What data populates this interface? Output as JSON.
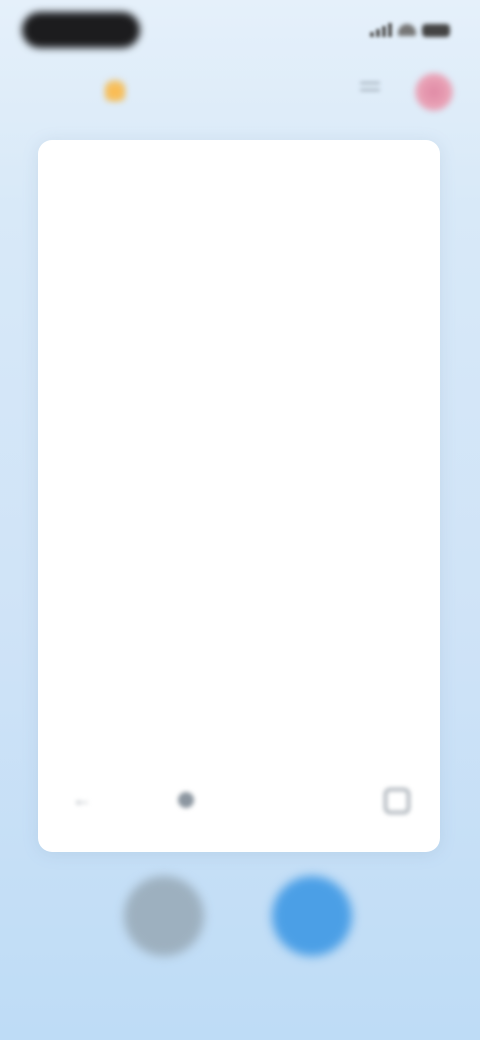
{
  "status_bar": {
    "pill_icon": "dynamic-island",
    "icons": [
      "signal-icon",
      "wifi-icon",
      "battery-icon"
    ]
  },
  "top_bar": {
    "streak_icon": "flame-icon",
    "title": "",
    "menu_icon": "menu-icon",
    "avatar_icon": "avatar"
  },
  "card": {
    "word": "",
    "phonetic": "",
    "definition": "",
    "example": "",
    "footer": {
      "back_icon": "arrow-left-icon",
      "speak_label": "",
      "more_icon": "square-icon"
    }
  },
  "actions": {
    "left_label": "",
    "right_label": ""
  },
  "colors": {
    "background": "#d8e9f8",
    "card": "#ffffff",
    "accent_blue": "#4b9fe6",
    "gray_button": "#9db0bf",
    "phonetic_blue": "#5c95d6",
    "avatar_pink": "#e08aa5",
    "streak_orange": "#ffb94a"
  }
}
